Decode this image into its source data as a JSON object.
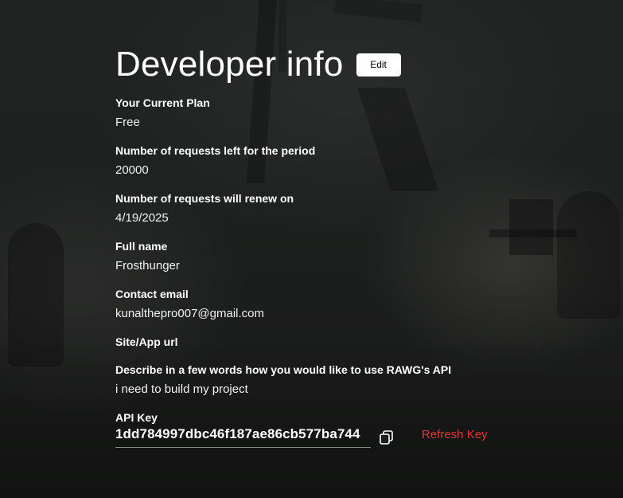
{
  "header": {
    "title": "Developer info",
    "edit_label": "Edit"
  },
  "fields": [
    {
      "label": "Your Current Plan",
      "value": "Free"
    },
    {
      "label": "Number of requests left for the period",
      "value": "20000"
    },
    {
      "label": "Number of requests will renew on",
      "value": "4/19/2025"
    },
    {
      "label": "Full name",
      "value": "Frosthunger"
    },
    {
      "label": "Contact email",
      "value": "kunalthepro007@gmail.com"
    },
    {
      "label": "Site/App url",
      "value": ""
    },
    {
      "label": "Describe in a few words how you would like to use RAWG's API",
      "value": "i need to build my project"
    }
  ],
  "api_key": {
    "label": "API Key",
    "value": "1dd784997dbc46f187ae86cb577ba744",
    "copy_icon": "copy-icon",
    "refresh_label": "Refresh Key"
  },
  "colors": {
    "accent": "#e0363a",
    "text": "#ffffff",
    "button_bg": "#ffffff"
  }
}
